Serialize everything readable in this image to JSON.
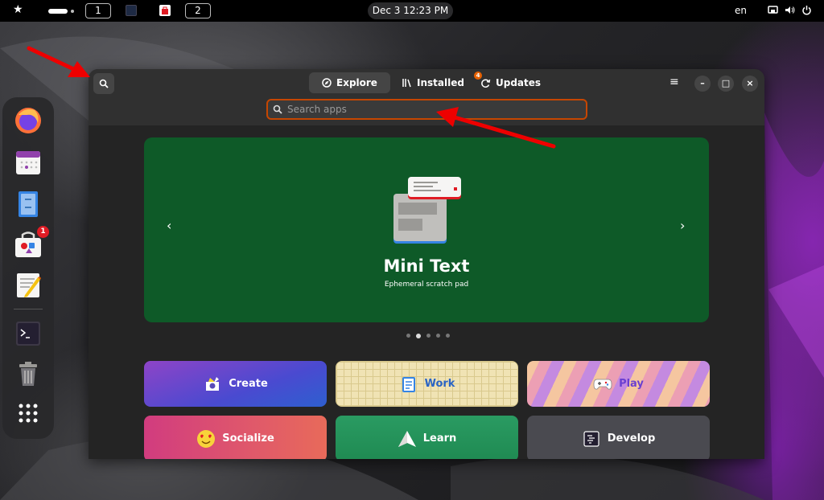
{
  "topbar": {
    "activities_icon": "star-icon",
    "workspace_1": "1",
    "workspace_2": "2",
    "clock": "Dec 3  12:23 PM",
    "language": "en"
  },
  "dock": {
    "items": [
      {
        "name": "Firefox",
        "icon": "firefox-icon"
      },
      {
        "name": "Calendar",
        "icon": "calendar-icon"
      },
      {
        "name": "Files",
        "icon": "files-icon"
      },
      {
        "name": "Software",
        "icon": "software-icon",
        "badge": "1"
      },
      {
        "name": "Text Editor",
        "icon": "text-editor-icon"
      },
      {
        "name": "Terminal",
        "icon": "terminal-icon"
      },
      {
        "name": "Trash",
        "icon": "trash-icon"
      },
      {
        "name": "Show Apps",
        "icon": "app-grid-icon"
      }
    ]
  },
  "window": {
    "tabs": [
      {
        "label": "Explore",
        "icon": "compass-icon",
        "active": true
      },
      {
        "label": "Installed",
        "icon": "library-icon",
        "active": false
      },
      {
        "label": "Updates",
        "icon": "refresh-icon",
        "active": false,
        "badge": "4"
      }
    ],
    "search": {
      "placeholder": "Search apps",
      "value": ""
    },
    "controls": {
      "menu": "≡",
      "minimize": "–",
      "maximize": "□",
      "close": "×"
    }
  },
  "carousel": {
    "title": "Mini Text",
    "subtitle": "Ephemeral scratch pad",
    "prev": "‹",
    "next": "›",
    "total_pages": 5,
    "active_page": 2,
    "background": "#0e5a28"
  },
  "categories": [
    {
      "label": "Create",
      "icon": "create-icon"
    },
    {
      "label": "Work",
      "icon": "work-icon"
    },
    {
      "label": "Play",
      "icon": "gamepad-icon"
    },
    {
      "label": "Socialize",
      "icon": "smiley-icon"
    },
    {
      "label": "Learn",
      "icon": "paper-plane-icon"
    },
    {
      "label": "Develop",
      "icon": "code-icon"
    }
  ],
  "colors": {
    "accent_border": "#c64600",
    "annotation_arrow": "#ee0000"
  }
}
